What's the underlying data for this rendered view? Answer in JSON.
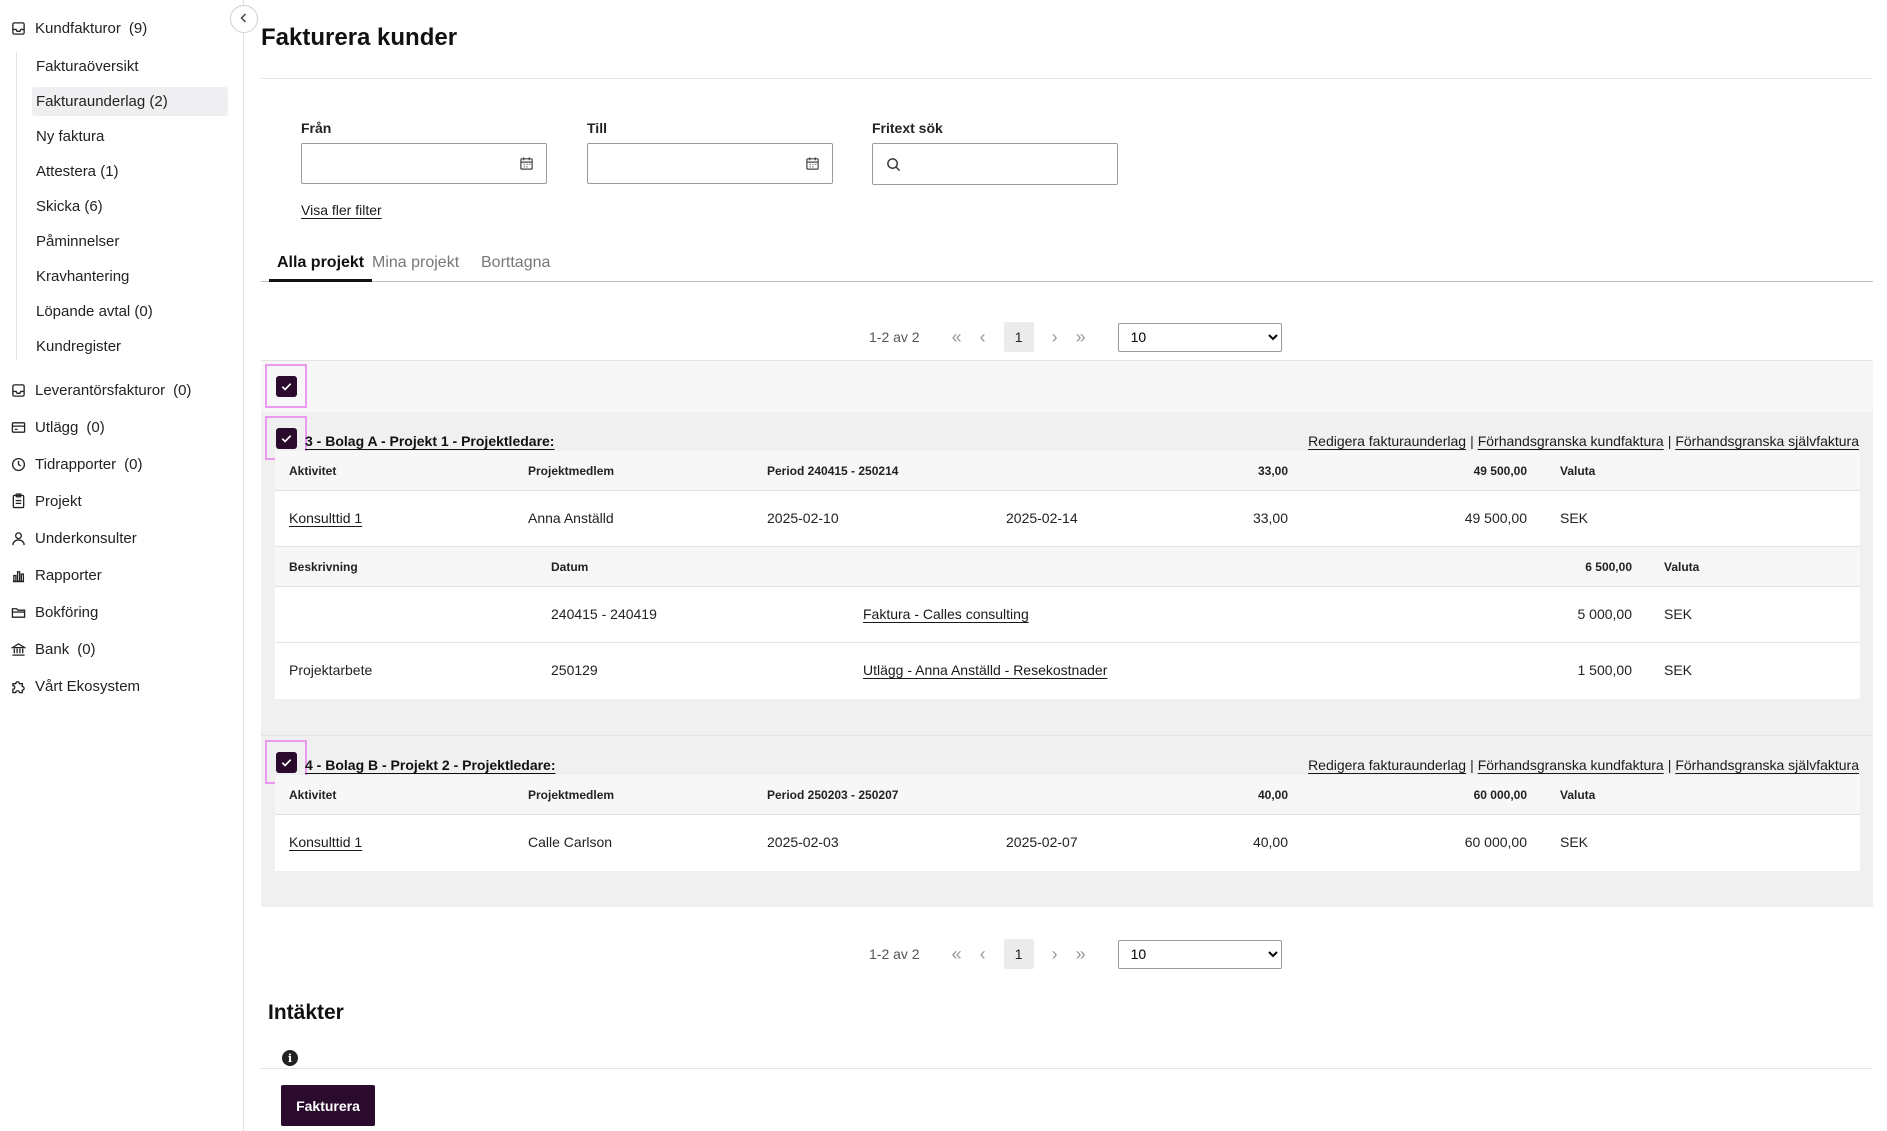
{
  "sidebar": {
    "kundfakturor": {
      "label": "Kundfakturor",
      "count": "(9)"
    },
    "sub": [
      {
        "label": "Fakturaöversikt"
      },
      {
        "label": "Fakturaunderlag (2)"
      },
      {
        "label": "Ny faktura"
      },
      {
        "label": "Attestera (1)"
      },
      {
        "label": "Skicka (6)"
      },
      {
        "label": "Påminnelser"
      },
      {
        "label": "Kravhantering"
      },
      {
        "label": "Löpande avtal (0)"
      },
      {
        "label": "Kundregister"
      }
    ],
    "main": [
      {
        "label": "Leverantörsfakturor",
        "count": "(0)",
        "icon": "inbox-icon"
      },
      {
        "label": "Utlägg",
        "count": "(0)",
        "icon": "wallet-icon"
      },
      {
        "label": "Tidrapporter",
        "count": "(0)",
        "icon": "clock-icon"
      },
      {
        "label": "Projekt",
        "count": "",
        "icon": "clipboard-icon"
      },
      {
        "label": "Underkonsulter",
        "count": "",
        "icon": "user-icon"
      },
      {
        "label": "Rapporter",
        "count": "",
        "icon": "bar-chart-icon"
      },
      {
        "label": "Bokföring",
        "count": "",
        "icon": "folder-icon"
      },
      {
        "label": "Bank",
        "count": "(0)",
        "icon": "bank-icon"
      },
      {
        "label": "Vårt Ekosystem",
        "count": "",
        "icon": "puzzle-icon"
      }
    ]
  },
  "page": {
    "title": "Fakturera kunder"
  },
  "filters": {
    "from_label": "Från",
    "from_value": "",
    "to_label": "Till",
    "to_value": "",
    "search_label": "Fritext sök",
    "search_value": "",
    "more_filters": "Visa fler filter"
  },
  "tabs": [
    {
      "label": "Alla projekt",
      "active": true
    },
    {
      "label": "Mina projekt",
      "active": false
    },
    {
      "label": "Borttagna",
      "active": false
    }
  ],
  "pager": {
    "info": "1-2 av 2",
    "page": "1",
    "per_page": "10",
    "first": "«",
    "prev": "‹",
    "next": "›",
    "last": "»"
  },
  "groups": [
    {
      "title": "3 - Bolag A - Projekt 1 - Projektledare:",
      "links": [
        "Redigera fakturaunderlag",
        "Förhandsgranska kundfaktura",
        "Förhandsgranska självfaktura"
      ],
      "separator": "|",
      "header": {
        "activity": "Aktivitet",
        "member": "Projektmedlem",
        "period": "Period 240415 - 250214",
        "hours": "33,00",
        "amount": "49 500,00",
        "currency": "Valuta"
      },
      "row": {
        "activity": "Konsulttid 1",
        "member": "Anna Anställd",
        "start": "2025-02-10",
        "end": "2025-02-14",
        "hours": "33,00",
        "amount": "49 500,00",
        "currency": "SEK"
      },
      "sub_header": {
        "desc": "Beskrivning",
        "date": "Datum",
        "amount": "6 500,00",
        "currency": "Valuta"
      },
      "sub_rows": [
        {
          "desc": "",
          "date": "240415 - 240419",
          "link": "Faktura - Calles consulting",
          "amount": "5 000,00",
          "currency": "SEK"
        },
        {
          "desc": "Projektarbete",
          "date": "250129",
          "link": "Utlägg - Anna Anställd - Resekostnader",
          "amount": "1 500,00",
          "currency": "SEK"
        }
      ]
    },
    {
      "title": "4 - Bolag B - Projekt 2 - Projektledare:",
      "links": [
        "Redigera fakturaunderlag",
        "Förhandsgranska kundfaktura",
        "Förhandsgranska självfaktura"
      ],
      "separator": "|",
      "header": {
        "activity": "Aktivitet",
        "member": "Projektmedlem",
        "period": "Period 250203 - 250207",
        "hours": "40,00",
        "amount": "60 000,00",
        "currency": "Valuta"
      },
      "row": {
        "activity": "Konsulttid 1",
        "member": "Calle Carlson",
        "start": "2025-02-03",
        "end": "2025-02-07",
        "hours": "40,00",
        "amount": "60 000,00",
        "currency": "SEK"
      }
    }
  ],
  "income": {
    "title": "Intäkter",
    "info": "i"
  },
  "actions": {
    "invoice": "Fakturera"
  },
  "colors": {
    "brand": "#2a0b2e",
    "highlight": "#ea9bf0"
  }
}
